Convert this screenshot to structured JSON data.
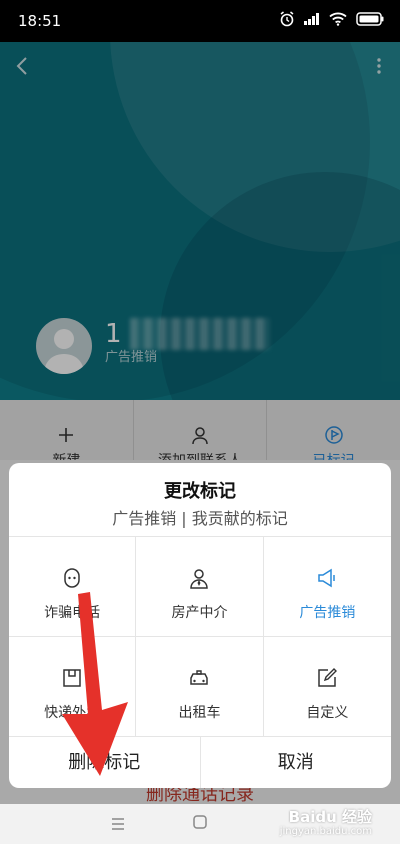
{
  "status_bar": {
    "time": "18:51"
  },
  "contact": {
    "number_prefix": "1",
    "tag": "广告推销"
  },
  "actions": [
    {
      "label": "新建",
      "icon": "plus-icon"
    },
    {
      "label": "添加到联系人",
      "icon": "person-icon"
    },
    {
      "label": "已标记",
      "icon": "flag-icon"
    }
  ],
  "dialog": {
    "title": "更改标记",
    "subtitle": "广告推销 | 我贡献的标记",
    "options": [
      {
        "label": "诈骗电话",
        "icon": "mask-icon",
        "selected": false
      },
      {
        "label": "房产中介",
        "icon": "agent-icon",
        "selected": false
      },
      {
        "label": "广告推销",
        "icon": "megaphone-icon",
        "selected": true
      },
      {
        "label": "快递外卖",
        "icon": "package-icon",
        "selected": false
      },
      {
        "label": "出租车",
        "icon": "taxi-icon",
        "selected": false
      },
      {
        "label": "自定义",
        "icon": "edit-icon",
        "selected": false
      }
    ],
    "delete_button": "删除标记",
    "cancel_button": "取消"
  },
  "background_button": "删除通话记录",
  "watermark": {
    "text": "Baidu 经验",
    "sub": "jingyan.baidu.com"
  },
  "colors": {
    "header": "#0f7f8b",
    "accent": "#2a8ad8",
    "arrow": "#e5312a"
  }
}
